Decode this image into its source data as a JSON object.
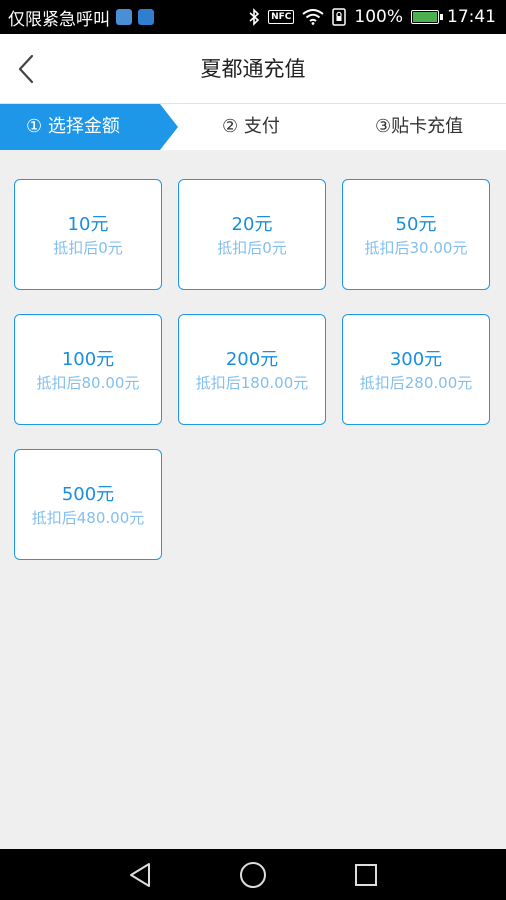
{
  "status_bar": {
    "carrier_text": "仅限紧急呼叫",
    "nfc_label": "NFC",
    "battery": "100%",
    "time": "17:41",
    "battery_color": "#4caf50"
  },
  "header": {
    "title": "夏都通充值"
  },
  "steps": [
    {
      "label": "① 选择金额",
      "active": true
    },
    {
      "label": "② 支付",
      "active": false
    },
    {
      "label": "③贴卡充值",
      "active": false
    }
  ],
  "accent_color": "#1e97e8",
  "amounts": [
    {
      "amount": "10元",
      "after": "抵扣后0元"
    },
    {
      "amount": "20元",
      "after": "抵扣后0元"
    },
    {
      "amount": "50元",
      "after": "抵扣后30.00元"
    },
    {
      "amount": "100元",
      "after": "抵扣后80.00元"
    },
    {
      "amount": "200元",
      "after": "抵扣后180.00元"
    },
    {
      "amount": "300元",
      "after": "抵扣后280.00元"
    },
    {
      "amount": "500元",
      "after": "抵扣后480.00元"
    }
  ],
  "nav_bar": {
    "icons": [
      "back-triangle-icon",
      "home-circle-icon",
      "recents-square-icon"
    ]
  }
}
